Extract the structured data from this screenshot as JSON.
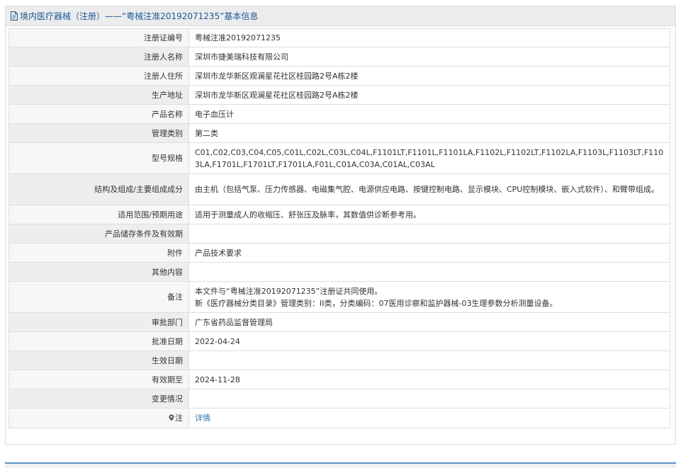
{
  "header": {
    "title": "境内医疗器械（注册）——“粤械注准20192071235”基本信息"
  },
  "rows": [
    {
      "label": "注册证编号",
      "value": "粤械注准20192071235",
      "h": 26
    },
    {
      "label": "注册人名称",
      "value": "深圳市捷美瑞科技有限公司",
      "h": 27
    },
    {
      "label": "注册人住所",
      "value": "深圳市龙华新区观澜星花社区桂园路2号A栋2楼",
      "h": 27
    },
    {
      "label": "生产地址",
      "value": "深圳市龙华新区观澜星花社区桂园路2号A栋2楼",
      "h": 27
    },
    {
      "label": "产品名称",
      "value": "电子血压计",
      "h": 27
    },
    {
      "label": "管理类别",
      "value": "第二类",
      "h": 27
    },
    {
      "label": "型号规格",
      "value": "C01,C02,C03,C04,C05,C01L,C02L,C03L,C04L,F1101LT,F1101L,F1101LA,F1102L,F1102LT,F1102LA,F1103L,F1103LT,F1103LA,F1701L,F1701LT,F1701LA,F01L,C01A,C03A,C01AL,C03AL",
      "h": 44
    },
    {
      "label": "结构及组成/主要组成成分",
      "value": "由主机（包括气泵、压力传感器、电磁集气腔、电源供应电路、按键控制电路、显示模块、CPU控制模块、嵌入式软件）、和臂带组成。",
      "h": 44
    },
    {
      "label": "适用范围/预期用途",
      "value": "适用于测量成人的收缩压、舒张压及脉率，其数值供诊断参考用。",
      "h": 27
    },
    {
      "label": "产品储存条件及有效期",
      "value": "",
      "h": 27
    },
    {
      "label": "附件",
      "value": "产品技术要求",
      "h": 27
    },
    {
      "label": "其他内容",
      "value": "",
      "h": 27
    },
    {
      "label": "备注",
      "value": "本文件与“粤械注准20192071235”注册证共同使用。\n新《医疗器械分类目录》管理类别：II类，分类编码：07医用诊察和监护器械-03生理参数分析测量设备。",
      "h": 44
    },
    {
      "label": "审批部门",
      "value": "广东省药品监督管理局",
      "h": 27
    },
    {
      "label": "批准日期",
      "value": "2022-04-24",
      "h": 27
    },
    {
      "label": "生效日期",
      "value": "",
      "h": 27
    },
    {
      "label": "有效期至",
      "value": "2024-11-28",
      "h": 27
    },
    {
      "label": "变更情况",
      "value": "",
      "h": 27
    }
  ],
  "note_row": {
    "label": "注",
    "link": "详情",
    "icon": "pin-icon"
  },
  "colors": {
    "header_text": "#1a5a96",
    "link": "#2c74b6",
    "border": "#dedede"
  }
}
